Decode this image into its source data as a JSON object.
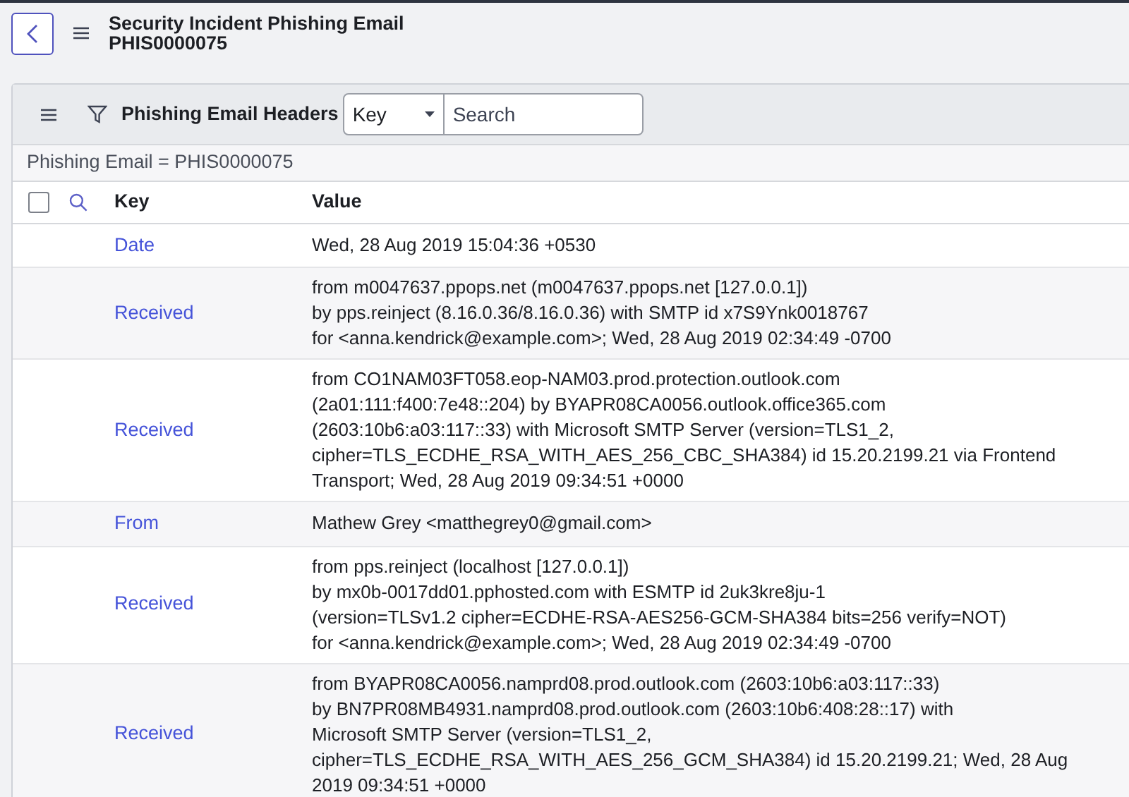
{
  "header": {
    "title": "Security Incident Phishing Email",
    "subtitle": "PHIS0000075"
  },
  "list": {
    "title": "Phishing Email Headers",
    "search_field": {
      "value": "Key"
    },
    "search": {
      "placeholder": "Search"
    },
    "filter": "Phishing Email = PHIS0000075",
    "select_all": {
      "checked": false
    },
    "columns": [
      "Key",
      "Value"
    ],
    "rows": [
      {
        "key": "Date",
        "value": [
          "Wed, 28 Aug 2019 15:04:36 +0530"
        ]
      },
      {
        "key": "Received",
        "value": [
          "from m0047637.ppops.net (m0047637.ppops.net [127.0.0.1])",
          "by pps.reinject (8.16.0.36/8.16.0.36) with SMTP id x7S9Ynk0018767",
          "for <anna.kendrick@example.com>; Wed, 28 Aug 2019 02:34:49 -0700"
        ]
      },
      {
        "key": "Received",
        "value": [
          "from CO1NAM03FT058.eop-NAM03.prod.protection.outlook.com",
          "(2a01:111:f400:7e48::204) by BYAPR08CA0056.outlook.office365.com",
          "(2603:10b6:a03:117::33) with Microsoft SMTP Server (version=TLS1_2,",
          "cipher=TLS_ECDHE_RSA_WITH_AES_256_CBC_SHA384) id 15.20.2199.21 via Frontend",
          "Transport; Wed, 28 Aug 2019 09:34:51 +0000"
        ]
      },
      {
        "key": "From",
        "value": [
          "Mathew Grey <matthegrey0@gmail.com>"
        ]
      },
      {
        "key": "Received",
        "value": [
          "from pps.reinject (localhost [127.0.0.1])",
          "by mx0b-0017dd01.pphosted.com with ESMTP id 2uk3kre8ju-1",
          "(version=TLSv1.2 cipher=ECDHE-RSA-AES256-GCM-SHA384 bits=256 verify=NOT)",
          "for <anna.kendrick@example.com>; Wed, 28 Aug 2019 02:34:49 -0700"
        ]
      },
      {
        "key": "Received",
        "value": [
          "from BYAPR08CA0056.namprd08.prod.outlook.com (2603:10b6:a03:117::33)",
          "by BN7PR08MB4931.namprd08.prod.outlook.com (2603:10b6:408:28::17) with",
          "Microsoft SMTP Server (version=TLS1_2,",
          "cipher=TLS_ECDHE_RSA_WITH_AES_256_GCM_SHA384) id 15.20.2199.21; Wed, 28 Aug",
          "2019 09:34:51 +0000"
        ]
      }
    ]
  }
}
